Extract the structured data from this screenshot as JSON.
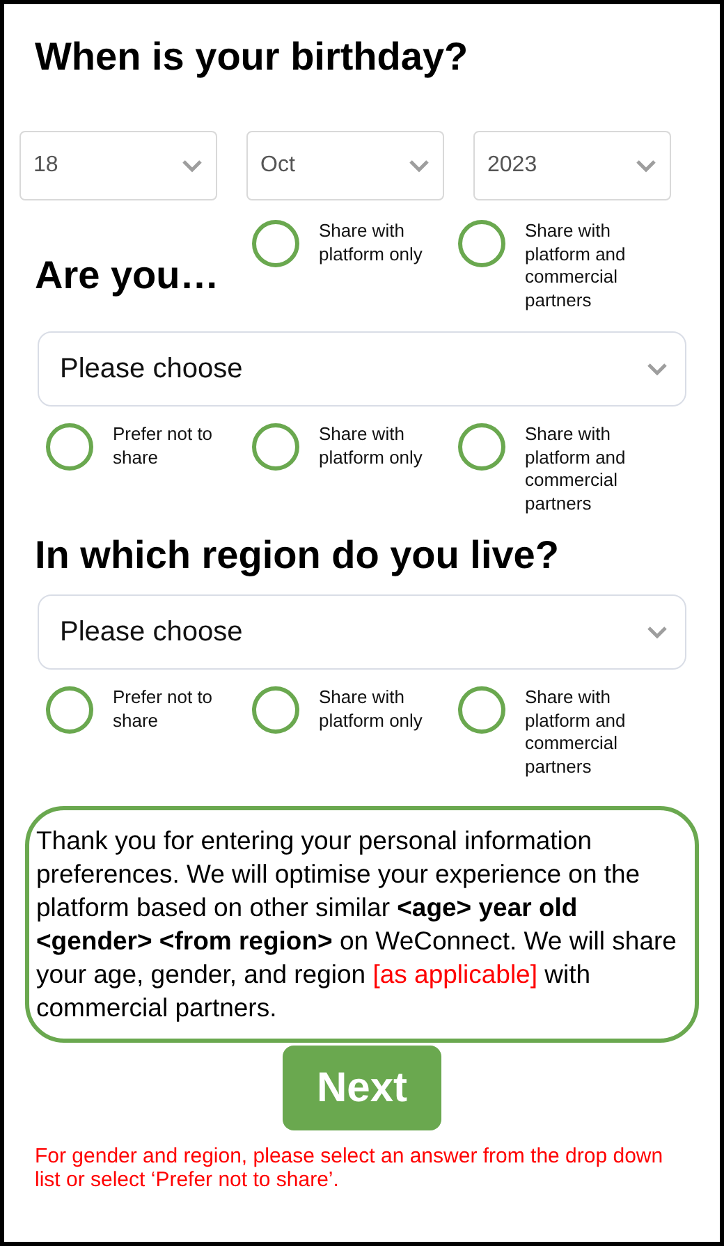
{
  "birthday": {
    "title": "When is your birthday?",
    "selects": [
      {
        "value": "18"
      },
      {
        "value": "Oct"
      },
      {
        "value": "2023"
      }
    ],
    "options": [
      {
        "label": "Share with platform only",
        "selected": false
      },
      {
        "label": "Share with platform and commercial partners",
        "selected": false
      }
    ]
  },
  "gender": {
    "title": "Are you…",
    "select": {
      "value": "Please choose"
    },
    "options": [
      {
        "label": "Prefer not to share",
        "selected": false
      },
      {
        "label": "Share with platform only",
        "selected": false
      },
      {
        "label": "Share with platform and commercial partners",
        "selected": false
      }
    ]
  },
  "region": {
    "title": "In which region do you live?",
    "select": {
      "value": "Please choose"
    },
    "options": [
      {
        "label": "Prefer not to share",
        "selected": false
      },
      {
        "label": "Share with platform only",
        "selected": false
      },
      {
        "label": "Share with platform and commercial partners",
        "selected": false
      }
    ]
  },
  "info": [
    {
      "kind": "plain",
      "text": "Thank you for entering your personal information preferences. We will optimise your experience on the platform based on other similar "
    },
    {
      "kind": "bold",
      "text": "<age> year old <gender> <from region>"
    },
    {
      "kind": "plain",
      "text": " on WeConnect. We will share your age, gender, and region "
    },
    {
      "kind": "alert",
      "text": "[as applicable]"
    },
    {
      "kind": "plain",
      "text": " with commercial partners."
    }
  ],
  "next_button": "Next",
  "footer_note": "For gender and region, please select an answer from the drop down list or select ‘Prefer not to share’."
}
